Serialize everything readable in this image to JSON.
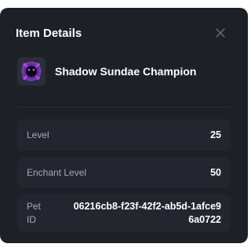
{
  "modal": {
    "title": "Item Details",
    "close_icon": "close-icon"
  },
  "item": {
    "name": "Shadow Sundae Champion",
    "icon": "shadow-sundae-champion-icon",
    "icon_colors": [
      "#5b2a8c",
      "#8a3fd6",
      "#12081f"
    ]
  },
  "stats": {
    "level": {
      "label": "Level",
      "value": "25"
    },
    "enchant": {
      "label": "Enchant Level",
      "value": "50"
    },
    "pet_id": {
      "label": "Pet ID",
      "value": "06216cb8-f23f-42f2-ab5d-1afce96a0722"
    }
  },
  "colors": {
    "background": "#1d2027",
    "card": "#23262e",
    "text": "#ffffff",
    "muted": "#a6aab3"
  }
}
